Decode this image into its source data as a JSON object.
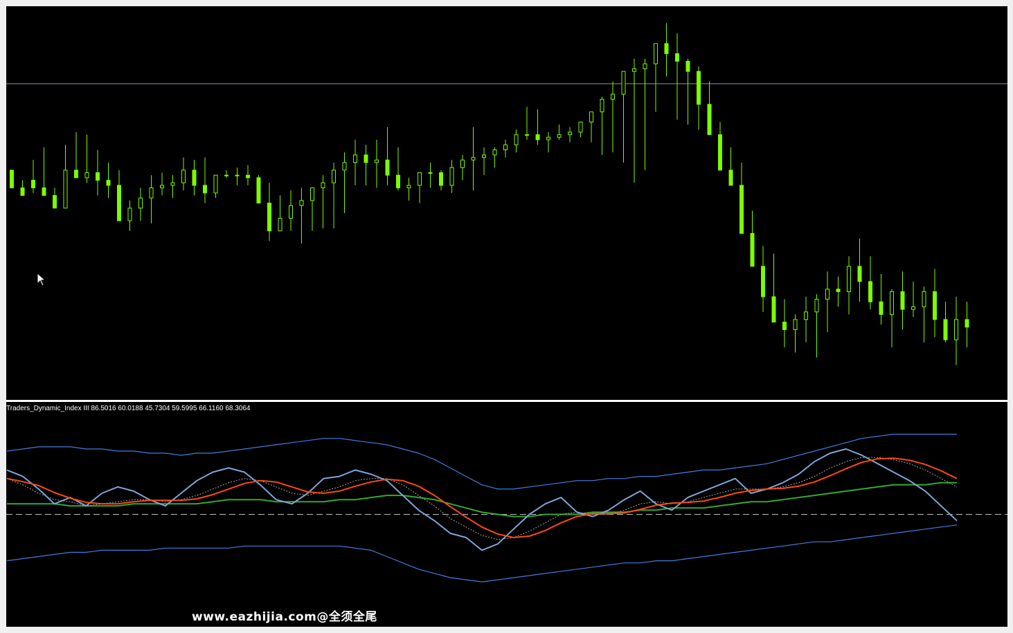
{
  "indicator": {
    "label": "Traders_Dynamic_Index III 86.5016 60.0188 45.7304 59.5995 66.1160 68.3064",
    "midline": 50
  },
  "watermark": "www.eazhijia.com@全须全尾",
  "colors": {
    "background": "#000000",
    "candle": "#7cfc00",
    "horizontal_line": "#8899aa",
    "rsi_line": "#7fa6d8",
    "bands": "#3f7fe0",
    "trade_signal": "#33aa33",
    "market_base": "#ff4a10",
    "fast_ma": "#aaaaaa",
    "midline": "#c0c0c0"
  },
  "chart_data": [
    {
      "type": "candlestick",
      "series": [
        {
          "name": "",
          "values": [
            [
              18,
              15,
              13,
              11
            ],
            [
              11,
              14,
              10,
              8
            ],
            [
              14,
              22,
              9,
              11
            ],
            [
              11,
              27,
              11,
              8
            ],
            [
              8,
              11,
              4,
              3
            ],
            [
              3,
              28,
              4,
              18
            ],
            [
              18,
              33,
              18,
              15
            ],
            [
              15,
              32,
              13,
              17
            ],
            [
              17,
              26,
              8,
              14
            ],
            [
              14,
              21,
              7,
              12
            ],
            [
              12,
              18,
              2,
              -2
            ],
            [
              -2,
              6,
              -6,
              3
            ],
            [
              3,
              11,
              -2,
              7
            ],
            [
              7,
              16,
              -3,
              11
            ],
            [
              11,
              17,
              8,
              12
            ],
            [
              12,
              16,
              7,
              13
            ],
            [
              13,
              23,
              10,
              18
            ],
            [
              18,
              22,
              8,
              12
            ],
            [
              12,
              23,
              5,
              9
            ],
            [
              9,
              16,
              7,
              16
            ],
            [
              16,
              18,
              15,
              16
            ],
            [
              16,
              19,
              12,
              16
            ],
            [
              16,
              20,
              12,
              15
            ],
            [
              15,
              16,
              10,
              5
            ],
            [
              5,
              13,
              -10,
              -6
            ],
            [
              -6,
              8,
              -6,
              -1
            ],
            [
              -1,
              10,
              -6,
              4
            ],
            [
              4,
              11,
              -11,
              6
            ],
            [
              6,
              8,
              -6,
              11
            ],
            [
              11,
              16,
              -5,
              13
            ],
            [
              13,
              21,
              -5,
              18
            ],
            [
              18,
              25,
              1,
              21
            ],
            [
              21,
              30,
              12,
              24
            ],
            [
              24,
              28,
              12,
              21
            ],
            [
              21,
              30,
              11,
              22
            ],
            [
              22,
              35,
              12,
              16
            ],
            [
              16,
              27,
              10,
              11
            ],
            [
              11,
              15,
              6,
              12
            ],
            [
              12,
              14,
              5,
              17
            ],
            [
              17,
              21,
              11,
              17
            ],
            [
              17,
              18,
              10,
              12
            ],
            [
              12,
              22,
              9,
              19
            ],
            [
              19,
              24,
              14,
              22
            ],
            [
              22,
              35,
              10,
              23
            ],
            [
              23,
              27,
              16,
              24
            ],
            [
              24,
              27,
              19,
              26
            ],
            [
              26,
              30,
              23,
              28
            ],
            [
              28,
              34,
              25,
              32
            ],
            [
              32,
              43,
              30,
              32
            ],
            [
              32,
              42,
              28,
              30
            ],
            [
              30,
              33,
              25,
              31
            ],
            [
              31,
              36,
              30,
              32
            ],
            [
              32,
              35,
              29,
              33
            ],
            [
              33,
              37,
              31,
              37
            ],
            [
              37,
              39,
              29,
              41
            ],
            [
              41,
              47,
              24,
              46
            ],
            [
              46,
              53,
              25,
              48
            ],
            [
              48,
              51,
              21,
              57
            ],
            [
              57,
              62,
              13,
              58
            ],
            [
              58,
              62,
              18,
              60
            ],
            [
              60,
              65,
              41,
              68
            ],
            [
              68,
              76,
              55,
              64
            ],
            [
              64,
              72,
              38,
              61
            ],
            [
              61,
              62,
              36,
              57
            ],
            [
              57,
              59,
              34,
              44
            ],
            [
              44,
              53,
              33,
              32
            ],
            [
              32,
              37,
              30,
              18
            ],
            [
              18,
              27,
              16,
              12
            ],
            [
              12,
              21,
              3,
              -7
            ],
            [
              -7,
              2,
              -10,
              -20
            ],
            [
              -20,
              -12,
              -38,
              -32
            ],
            [
              -32,
              -15,
              -38,
              -42
            ],
            [
              -42,
              -33,
              -52,
              -45
            ],
            [
              -45,
              -39,
              -54,
              -41
            ],
            [
              -41,
              -32,
              -50,
              -38
            ],
            [
              -38,
              -31,
              -56,
              -33
            ],
            [
              -33,
              -22,
              -46,
              -29
            ],
            [
              -29,
              -24,
              -36,
              -30
            ],
            [
              -30,
              -16,
              -39,
              -20
            ],
            [
              -20,
              -9,
              -34,
              -26
            ],
            [
              -26,
              -16,
              -37,
              -34
            ],
            [
              -34,
              -23,
              -43,
              -39
            ],
            [
              -39,
              -29,
              -52,
              -30
            ],
            [
              -30,
              -22,
              -45,
              -37
            ],
            [
              -37,
              -26,
              -40,
              -36
            ],
            [
              -36,
              -28,
              -50,
              -30
            ],
            [
              -30,
              -21,
              -48,
              -41
            ],
            [
              -41,
              -34,
              -50,
              -49
            ],
            [
              -49,
              -32,
              -59,
              -41
            ],
            [
              -41,
              -34,
              -52,
              -44
            ]
          ]
        }
      ]
    },
    {
      "type": "line",
      "ylim": [
        0,
        100
      ],
      "midline": 50,
      "series": [
        {
          "name": "",
          "values": [
            71,
            68,
            62,
            55,
            58,
            54,
            60,
            63,
            61,
            57,
            54,
            60,
            66,
            70,
            72,
            70,
            64,
            57,
            55,
            60,
            67,
            68,
            71,
            69,
            66,
            59,
            52,
            47,
            41,
            39,
            33,
            36,
            43,
            50,
            55,
            58,
            51,
            49,
            52,
            57,
            61,
            55,
            52,
            58,
            61,
            64,
            67,
            60,
            62,
            65,
            69,
            75,
            79,
            81,
            78,
            74,
            70,
            66,
            61,
            54,
            47
          ]
        },
        {
          "name": "",
          "values": [
            67,
            64,
            60,
            57,
            56,
            54,
            55,
            56,
            57,
            57,
            56,
            57,
            59,
            62,
            65,
            67,
            66,
            63,
            60,
            59,
            61,
            63,
            66,
            67,
            67,
            64,
            59,
            54,
            48,
            44,
            40,
            38,
            39,
            42,
            46,
            50,
            51,
            50,
            50,
            52,
            55,
            56,
            55,
            56,
            58,
            60,
            62,
            62,
            62,
            63,
            65,
            68,
            72,
            75,
            77,
            77,
            76,
            74,
            71,
            67,
            63
          ]
        },
        {
          "name": "",
          "values": [
            55,
            55,
            55,
            55,
            54,
            54,
            54,
            54,
            55,
            55,
            55,
            55,
            55,
            56,
            57,
            57,
            57,
            56,
            56,
            56,
            56,
            57,
            57,
            58,
            59,
            59,
            58,
            57,
            55,
            53,
            51,
            50,
            49,
            49,
            50,
            50,
            50,
            51,
            51,
            51,
            52,
            52,
            53,
            53,
            53,
            54,
            55,
            56,
            56,
            57,
            58,
            59,
            60,
            61,
            62,
            63,
            64,
            64,
            64,
            65,
            65
          ]
        },
        {
          "name": "",
          "values": [
            80,
            81,
            82,
            82,
            82,
            81,
            81,
            80,
            80,
            79,
            79,
            78,
            79,
            79,
            80,
            81,
            82,
            83,
            84,
            85,
            86,
            86,
            85,
            84,
            83,
            81,
            79,
            76,
            72,
            68,
            64,
            62,
            62,
            63,
            64,
            65,
            66,
            66,
            67,
            67,
            68,
            68,
            69,
            70,
            71,
            71,
            72,
            73,
            74,
            76,
            78,
            80,
            82,
            84,
            86,
            87,
            88,
            88,
            88,
            88,
            88
          ]
        },
        {
          "name": "",
          "values": [
            28,
            29,
            30,
            31,
            32,
            32,
            33,
            33,
            33,
            33,
            34,
            34,
            34,
            34,
            34,
            35,
            35,
            35,
            35,
            35,
            35,
            35,
            34,
            33,
            30,
            27,
            24,
            22,
            20,
            19,
            18,
            19,
            20,
            21,
            22,
            23,
            24,
            25,
            26,
            27,
            27,
            28,
            28,
            29,
            30,
            31,
            32,
            33,
            34,
            35,
            36,
            37,
            37,
            38,
            39,
            40,
            41,
            42,
            43,
            44,
            45
          ]
        }
      ]
    }
  ]
}
